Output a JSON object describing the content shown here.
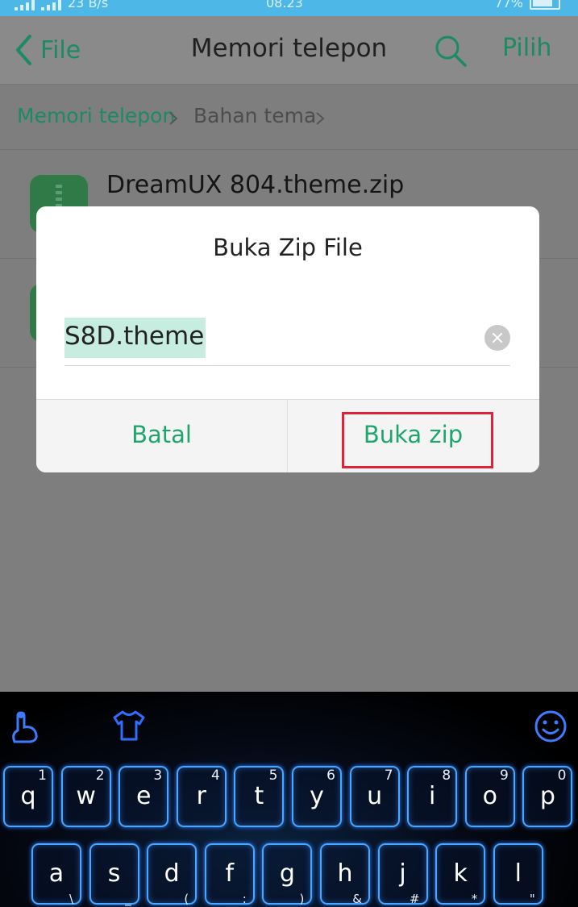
{
  "status_bar": {
    "speed": "23 B/s",
    "time": "08.23",
    "battery": "77%"
  },
  "app_bar": {
    "back_label": "File",
    "title": "Memori telepon",
    "pilih_label": "Pilih"
  },
  "breadcrumb": {
    "items": [
      "Memori telepon",
      "Bahan tema"
    ]
  },
  "files": [
    {
      "name": "DreamUX 804.theme.zip"
    },
    {
      "name": ""
    }
  ],
  "dialog": {
    "title": "Buka Zip File",
    "input_value": "S8D.theme",
    "cancel_label": "Batal",
    "ok_label": "Buka zip"
  },
  "keyboard": {
    "row1": [
      {
        "main": "q",
        "sub": "1"
      },
      {
        "main": "w",
        "sub": "2"
      },
      {
        "main": "e",
        "sub": "3"
      },
      {
        "main": "r",
        "sub": "4"
      },
      {
        "main": "t",
        "sub": "5"
      },
      {
        "main": "y",
        "sub": "6"
      },
      {
        "main": "u",
        "sub": "7"
      },
      {
        "main": "i",
        "sub": "8"
      },
      {
        "main": "o",
        "sub": "9"
      },
      {
        "main": "p",
        "sub": "0"
      }
    ],
    "row2": [
      {
        "main": "a",
        "sub": "\\"
      },
      {
        "main": "s",
        "sub": "_"
      },
      {
        "main": "d",
        "sub": "("
      },
      {
        "main": "f",
        "sub": ":"
      },
      {
        "main": "g",
        "sub": ")"
      },
      {
        "main": "h",
        "sub": "&"
      },
      {
        "main": "j",
        "sub": "#"
      },
      {
        "main": "k",
        "sub": "*"
      },
      {
        "main": "l",
        "sub": "\""
      }
    ]
  },
  "colors": {
    "accent": "#1ea56e",
    "highlight_box": "#e3203a",
    "status_bar": "#4db8e8",
    "key_glow": "#4aa6ff"
  }
}
